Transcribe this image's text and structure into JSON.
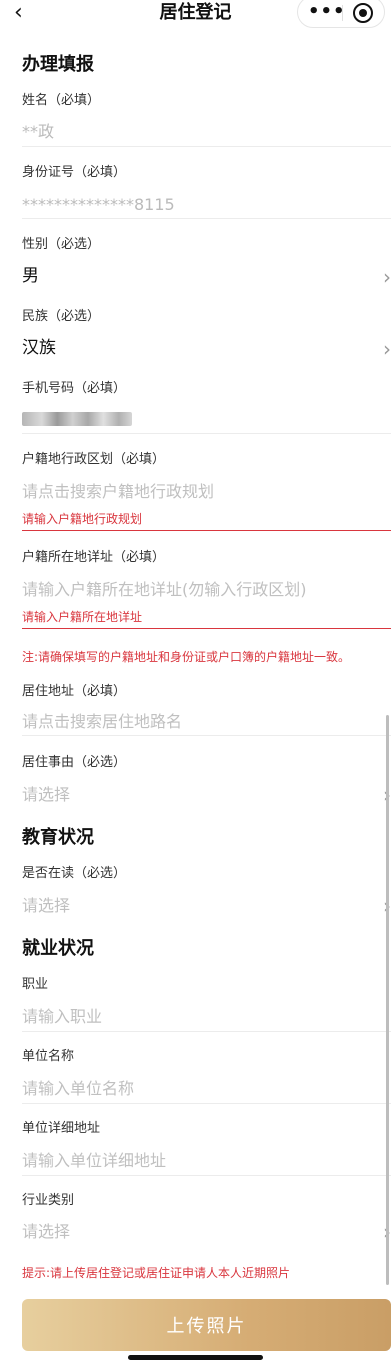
{
  "nav": {
    "back": "‹",
    "title": "居住登记",
    "more": "•••"
  },
  "sections": {
    "s1": "办理填报",
    "s2": "教育状况",
    "s3": "就业状况"
  },
  "fields": {
    "name": {
      "label": "姓名（必填）",
      "value": "**政"
    },
    "id": {
      "label": "身份证号（必填）",
      "value": "**************8115"
    },
    "gender": {
      "label": "性别（必选）",
      "value": "男"
    },
    "ethnicity": {
      "label": "民族（必选）",
      "value": "汉族"
    },
    "phone": {
      "label": "手机号码（必填）"
    },
    "huji_region": {
      "label": "户籍地行政区划（必填）",
      "placeholder": "请点击搜索户籍地行政规划",
      "error": "请输入户籍地行政规划"
    },
    "huji_address": {
      "label": "户籍所在地详址（必填）",
      "placeholder": "请输入户籍所在地详址(勿输入行政区划)",
      "error": "请输入户籍所在地详址"
    },
    "residence_address": {
      "label": "居住地址（必填）",
      "placeholder": "请点击搜索居住地路名"
    },
    "residence_reason": {
      "label": "居住事由（必选）",
      "placeholder": "请选择"
    },
    "in_school": {
      "label": "是否在读（必选）",
      "placeholder": "请选择"
    },
    "occupation": {
      "label": "职业",
      "placeholder": "请输入职业"
    },
    "employer": {
      "label": "单位名称",
      "placeholder": "请输入单位名称"
    },
    "employer_address": {
      "label": "单位详细地址",
      "placeholder": "请输入单位详细地址"
    },
    "industry": {
      "label": "行业类别",
      "placeholder": "请选择"
    }
  },
  "notes": {
    "address_note": "注:请确保填写的户籍地址和身份证或户口簿的户籍地址一致。",
    "photo_tip": "提示:请上传居住登记或居住证申请人本人近期照片"
  },
  "buttons": {
    "upload": "上传照片"
  },
  "colors": {
    "error": "#d9363e",
    "button_gradient_start": "#e7cf9e",
    "button_gradient_end": "#c99e66"
  }
}
